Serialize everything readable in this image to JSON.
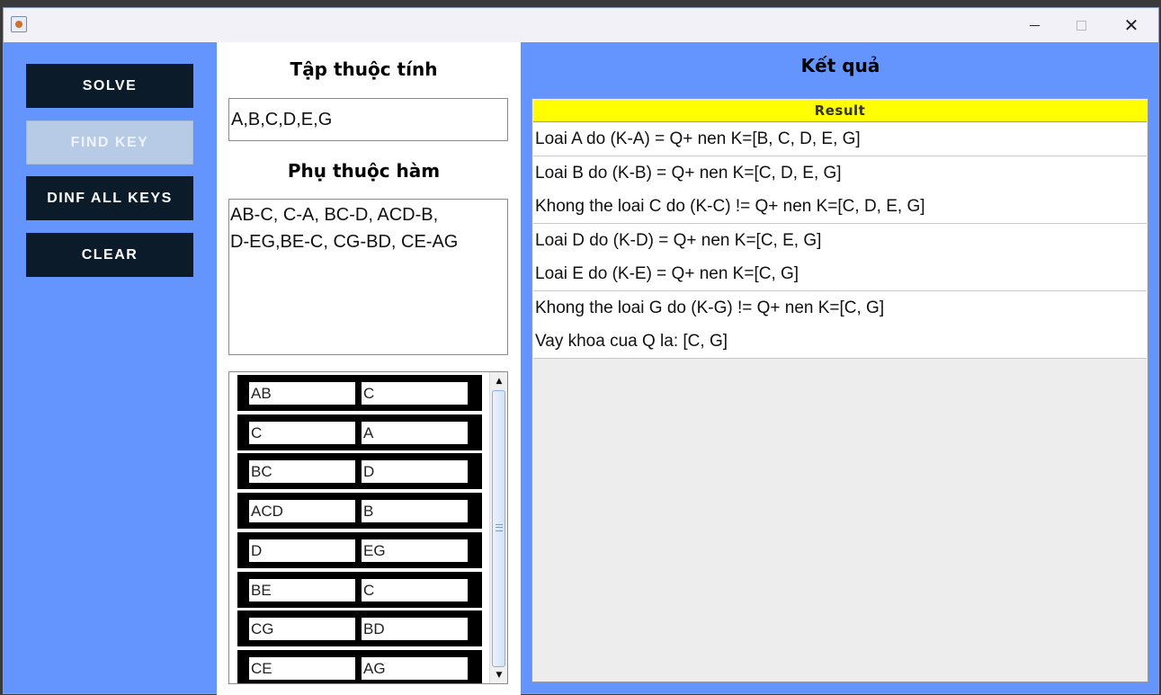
{
  "window": {
    "title": "",
    "icon": "java-app-icon"
  },
  "left_panel": {
    "buttons": [
      {
        "label": "SOLVE",
        "enabled": true
      },
      {
        "label": "FIND KEY",
        "enabled": false
      },
      {
        "label": "DINF ALL KEYS",
        "enabled": true
      },
      {
        "label": "CLEAR",
        "enabled": true
      }
    ]
  },
  "middle_panel": {
    "attributes_heading": "Tập thuộc tính",
    "attributes_value": "A,B,C,D,E,G",
    "fd_heading": "Phụ thuộc hàm",
    "fd_text": "AB-C, C-A, BC-D, ACD-B,\nD-EG,BE-C, CG-BD, CE-AG",
    "fd_rows": [
      {
        "left": "AB",
        "right": "C"
      },
      {
        "left": "C",
        "right": "A"
      },
      {
        "left": "BC",
        "right": "D"
      },
      {
        "left": "ACD",
        "right": "B"
      },
      {
        "left": "D",
        "right": "EG"
      },
      {
        "left": "BE",
        "right": "C"
      },
      {
        "left": "CG",
        "right": "BD"
      },
      {
        "left": "CE",
        "right": "AG"
      }
    ]
  },
  "result_panel": {
    "heading": "Kết quả",
    "column_header": "Result",
    "rows": [
      "Loai A do (K-A) = Q+ nen K=[B, C, D, E, G]",
      "Loai B do (K-B) = Q+ nen K=[C, D, E, G]",
      "Khong the loai C do (K-C) != Q+ nen K=[C, D, E, G]",
      "Loai D do (K-D) = Q+ nen K=[C, E, G]",
      "Loai E do (K-E) = Q+ nen K=[C, G]",
      "Khong the loai G do (K-G) != Q+ nen K=[C, G]",
      "Vay khoa cua Q la: [C, G]"
    ]
  },
  "colors": {
    "background": "#6495ff",
    "button_dark": "#0b1b2a",
    "button_disabled": "#b7cbe6",
    "header_yellow": "#ffff00"
  }
}
